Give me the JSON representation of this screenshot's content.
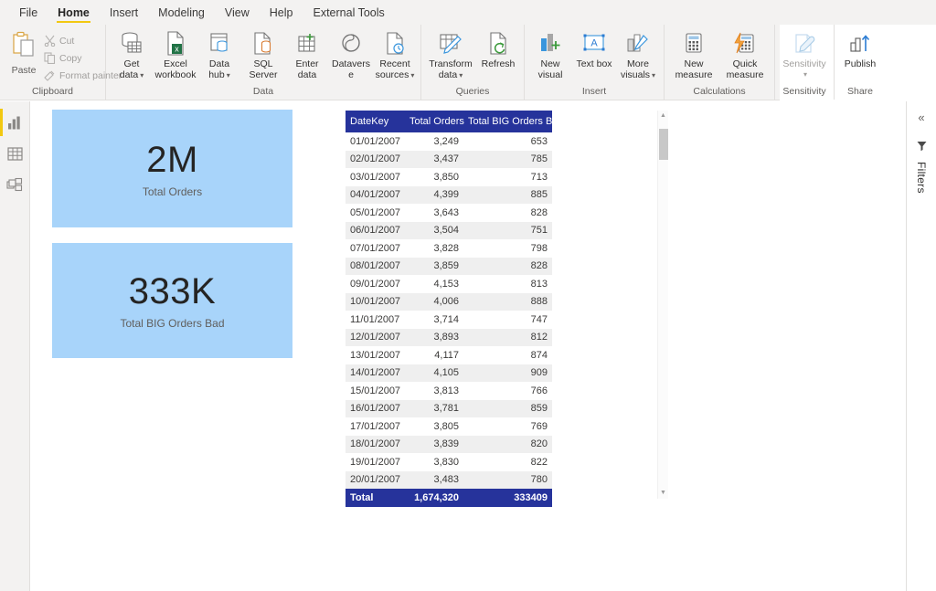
{
  "app": {
    "tabs": [
      {
        "label": "File",
        "active": false
      },
      {
        "label": "Home",
        "active": true
      },
      {
        "label": "Insert",
        "active": false
      },
      {
        "label": "Modeling",
        "active": false
      },
      {
        "label": "View",
        "active": false
      },
      {
        "label": "Help",
        "active": false
      },
      {
        "label": "External Tools",
        "active": false
      }
    ],
    "accent_yellow": "#f2c811",
    "ribbon_bg": "#f3f2f1"
  },
  "ribbon": {
    "clipboard": {
      "group_label": "Clipboard",
      "paste_label": "Paste",
      "cut_label": "Cut",
      "copy_label": "Copy",
      "format_painter_label": "Format painter"
    },
    "data": {
      "group_label": "Data",
      "items": [
        {
          "label": "Get data",
          "caret": true
        },
        {
          "label": "Excel workbook",
          "caret": false
        },
        {
          "label": "Data hub",
          "caret": true
        },
        {
          "label": "SQL Server",
          "caret": false
        },
        {
          "label": "Enter data",
          "caret": false
        },
        {
          "label": "Dataverse",
          "caret": false
        },
        {
          "label": "Recent sources",
          "caret": true
        }
      ]
    },
    "queries": {
      "group_label": "Queries",
      "items": [
        {
          "label": "Transform data",
          "caret": true
        },
        {
          "label": "Refresh",
          "caret": false
        }
      ]
    },
    "insert": {
      "group_label": "Insert",
      "items": [
        {
          "label": "New visual",
          "caret": false
        },
        {
          "label": "Text box",
          "caret": false
        },
        {
          "label": "More visuals",
          "caret": true
        }
      ]
    },
    "calculations": {
      "group_label": "Calculations",
      "items": [
        {
          "label": "New measure",
          "caret": false
        },
        {
          "label": "Quick measure",
          "caret": false
        }
      ]
    },
    "sensitivity": {
      "group_label": "Sensitivity",
      "items": [
        {
          "label": "Sensitivity",
          "caret": true,
          "disabled": true
        }
      ]
    },
    "share": {
      "group_label": "Share",
      "items": [
        {
          "label": "Publish",
          "caret": false
        }
      ]
    }
  },
  "left_rail": {
    "items": [
      {
        "name": "report-view",
        "active": true
      },
      {
        "name": "data-view",
        "active": false
      },
      {
        "name": "model-view",
        "active": false
      }
    ]
  },
  "cards": [
    {
      "value": "2M",
      "caption": "Total Orders",
      "bg": "#a8d4fa"
    },
    {
      "value": "333K",
      "caption": "Total BIG Orders Bad",
      "bg": "#a8d4fa"
    }
  ],
  "table": {
    "header_bg": "#26339b",
    "header_fg": "#ffffff",
    "columns": [
      "DateKey",
      "Total Orders",
      "Total BIG Orders Bad"
    ],
    "rows": [
      [
        "01/01/2007",
        "3,249",
        "653"
      ],
      [
        "02/01/2007",
        "3,437",
        "785"
      ],
      [
        "03/01/2007",
        "3,850",
        "713"
      ],
      [
        "04/01/2007",
        "4,399",
        "885"
      ],
      [
        "05/01/2007",
        "3,643",
        "828"
      ],
      [
        "06/01/2007",
        "3,504",
        "751"
      ],
      [
        "07/01/2007",
        "3,828",
        "798"
      ],
      [
        "08/01/2007",
        "3,859",
        "828"
      ],
      [
        "09/01/2007",
        "4,153",
        "813"
      ],
      [
        "10/01/2007",
        "4,006",
        "888"
      ],
      [
        "11/01/2007",
        "3,714",
        "747"
      ],
      [
        "12/01/2007",
        "3,893",
        "812"
      ],
      [
        "13/01/2007",
        "4,117",
        "874"
      ],
      [
        "14/01/2007",
        "4,105",
        "909"
      ],
      [
        "15/01/2007",
        "3,813",
        "766"
      ],
      [
        "16/01/2007",
        "3,781",
        "859"
      ],
      [
        "17/01/2007",
        "3,805",
        "769"
      ],
      [
        "18/01/2007",
        "3,839",
        "820"
      ],
      [
        "19/01/2007",
        "3,830",
        "822"
      ],
      [
        "20/01/2007",
        "3,483",
        "780"
      ]
    ],
    "total_row": [
      "Total",
      "1,674,320",
      "333409"
    ]
  },
  "filters_pane": {
    "expand_glyph": "«",
    "label": "Filters"
  }
}
